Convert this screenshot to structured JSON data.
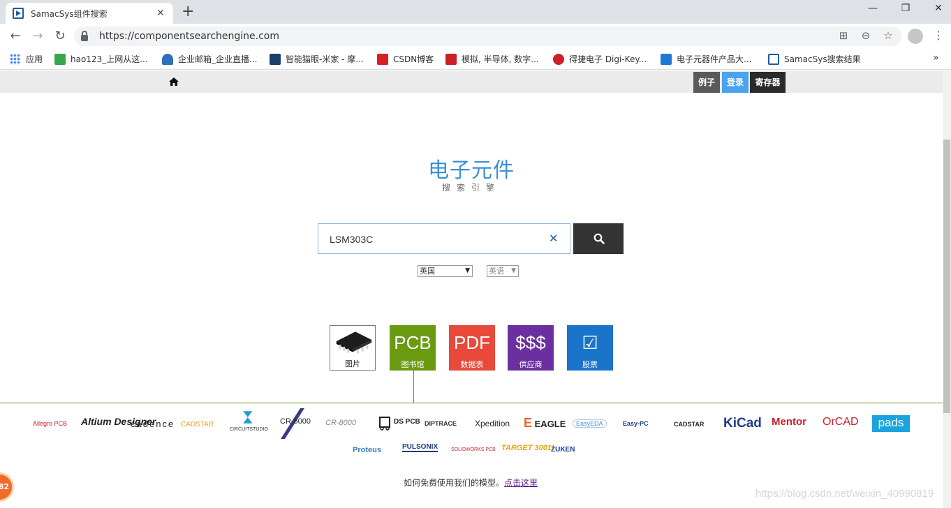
{
  "browser": {
    "tab_title": "SamacSys组件搜索",
    "tab_close": "✕",
    "new_tab": "+",
    "url": "https://componentsearchengine.com",
    "window_controls": {
      "minimize": "—",
      "maximize": "❐",
      "close": "✕"
    }
  },
  "bookmarks": [
    {
      "label": "应用",
      "icon": "apps-grid-icon",
      "color": "#4285f4"
    },
    {
      "label": "hao123_上网从这...",
      "icon": "hao123-icon",
      "color": "#3aa54a"
    },
    {
      "label": "企业邮箱_企业直播...",
      "icon": "cloud-mail-icon",
      "color": "#2f6fbd"
    },
    {
      "label": "智能猫眼-米家 - 摩...",
      "icon": "cat-eye-icon",
      "color": "#1c3f6e"
    },
    {
      "label": "CSDN博客",
      "icon": "csdn-icon",
      "color": "#d71f26"
    },
    {
      "label": "模拟, 半导体, 数字...",
      "icon": "ti-icon",
      "color": "#cc2027"
    },
    {
      "label": "得捷电子 Digi-Key...",
      "icon": "digikey-icon",
      "color": "#cc2027"
    },
    {
      "label": "电子元器件产品大...",
      "icon": "lc-icon",
      "color": "#1e79d6"
    },
    {
      "label": "SamacSys搜索结果",
      "icon": "samacsys-icon",
      "color": "#1d5b9b"
    }
  ],
  "bookmarks_more": "»",
  "site_nav": {
    "examples": "例子",
    "login": "登录",
    "register": "寄存器"
  },
  "logo": {
    "title": "电子元件",
    "subtitle": "搜索引擎"
  },
  "search": {
    "value": "LSM303C",
    "clear": "✕"
  },
  "selects": {
    "country": "英国",
    "language": "英语"
  },
  "tiles": [
    {
      "big": "",
      "label": "图片",
      "color": "#ffffff"
    },
    {
      "big": "PCB",
      "label": "图书馆",
      "color": "#6a9a10"
    },
    {
      "big": "PDF",
      "label": "数据表",
      "color": "#e8493a"
    },
    {
      "big": "$$$",
      "label": "供应商",
      "color": "#6b2fa0"
    },
    {
      "big": "☑",
      "label": "股票",
      "color": "#1a74c9"
    }
  ],
  "brands_row1": [
    "Allegro PCB",
    "Altium Designer",
    "cādence",
    "CADSTAR",
    "CIRCUITSTUDIO",
    "CR-5000",
    "CR-8000",
    "DS PCB",
    "DIPTRACE",
    "Xpedition",
    "EAGLE",
    "EasyEDA",
    "Easy-PC",
    "CADSTAR",
    "KiCad",
    "Mentor",
    "OrCAD",
    "pads"
  ],
  "brands_row2": [
    "Proteus",
    "PULSONIX",
    "SOLIDWORKS PCB",
    "TARGET 3001!",
    "ZUKEN"
  ],
  "footer": {
    "text": "如何免费使用我们的模型。",
    "link": "点击这里"
  },
  "watermark": "https://blog.csdn.net/weixin_40990819",
  "badge": "82"
}
